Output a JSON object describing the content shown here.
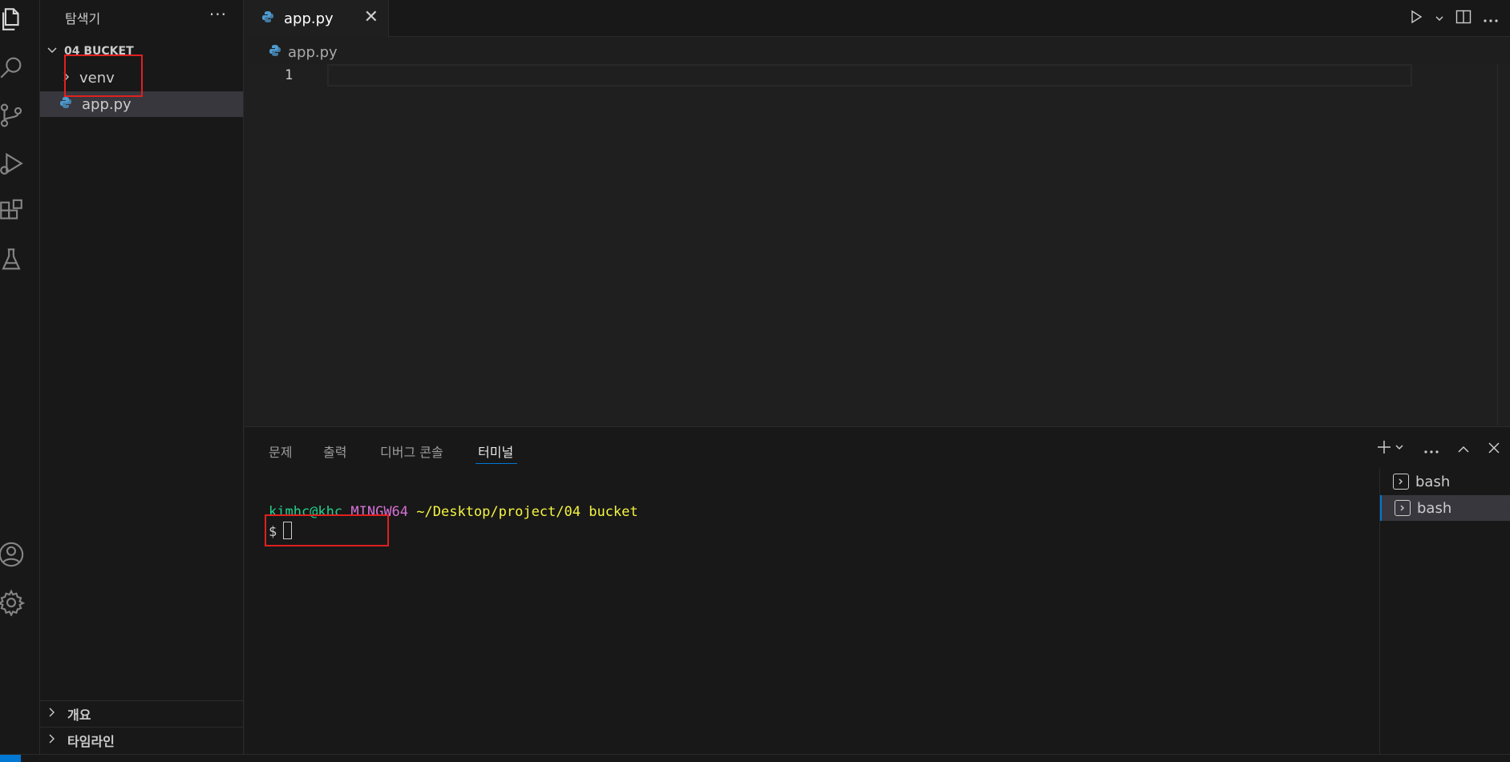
{
  "sidebar": {
    "title": "탐색기",
    "more": "···",
    "folder": "04 BUCKET",
    "items": [
      {
        "label": "venv",
        "kind": "folder"
      },
      {
        "label": "app.py",
        "kind": "python-file"
      }
    ],
    "sections": [
      {
        "label": "개요"
      },
      {
        "label": "타임라인"
      }
    ]
  },
  "editor": {
    "tab_label": "app.py",
    "close_glyph": "✕",
    "breadcrumb": "app.py",
    "line_number": "1"
  },
  "panel": {
    "tabs": [
      {
        "label": "문제"
      },
      {
        "label": "출력"
      },
      {
        "label": "디버그 콘솔"
      },
      {
        "label": "터미널"
      }
    ],
    "active_tab": "터미널",
    "terminal": {
      "user": "kimhc@khc",
      "host": "MINGW64",
      "path": "~/Desktop/project/04 bucket",
      "prompt": "$"
    },
    "terminals": [
      {
        "label": "bash"
      },
      {
        "label": "bash"
      }
    ]
  },
  "colors": {
    "accent": "#0078d4",
    "annotation": "#e02020"
  },
  "icons": [
    "files-icon",
    "search-icon",
    "source-control-icon",
    "run-debug-icon",
    "extensions-icon",
    "testing-icon",
    "account-icon",
    "settings-gear-icon"
  ]
}
